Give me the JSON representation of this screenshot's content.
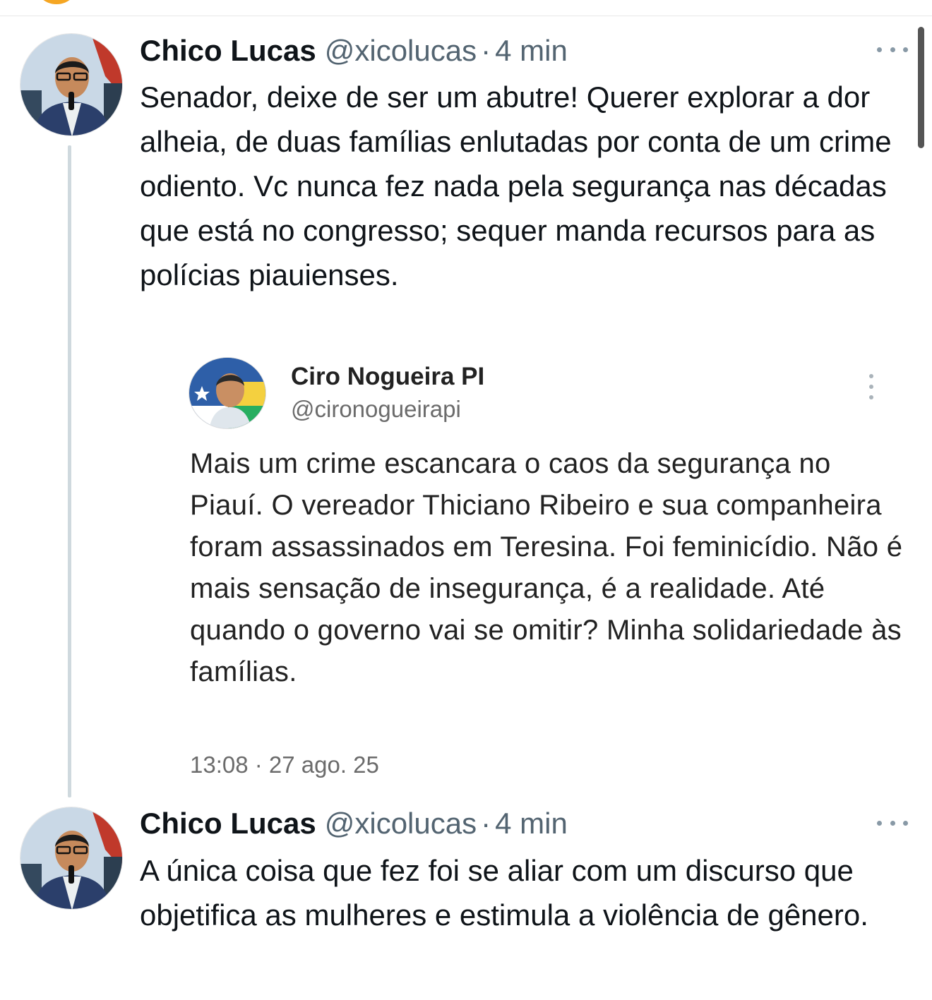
{
  "tweets": [
    {
      "name": "Chico Lucas",
      "handle": "@xicolucas",
      "separator": "·",
      "time": "4 min",
      "text": "Senador, deixe de ser um abutre! Querer explorar a dor alheia, de duas famílias enlutadas por conta de um crime odiento. Vc nunca fez nada pela segurança nas décadas que está no congresso; sequer manda recursos para as polícias piauienses."
    },
    {
      "name": "Chico Lucas",
      "handle": "@xicolucas",
      "separator": "·",
      "time": "4 min",
      "text": "A única coisa que fez foi se aliar com um discurso que objetifica as mulheres e estimula a violência de gênero."
    }
  ],
  "quoted": {
    "name": "Ciro Nogueira PI",
    "handle": "@cironogueirapi",
    "text": "Mais um crime escancara o caos da segurança no Piauí. O vereador Thiciano Ribeiro e sua companheira foram assassinados em Teresina. Foi feminicídio. Não é mais sensação de insegurança, é a realidade. Até quando o governo vai se omitir? Minha solidariedade às famílias.",
    "timestamp": "13:08 · 27 ago. 25"
  },
  "icons": {
    "more_horizontal": "more-horizontal-icon",
    "more_vertical": "more-vertical-icon"
  },
  "colors": {
    "text": "#0f1419",
    "secondary": "#536471",
    "thread_line": "#cfd9de"
  }
}
